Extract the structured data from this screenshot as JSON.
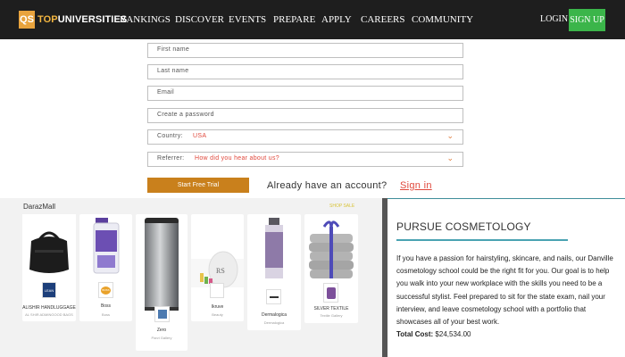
{
  "header": {
    "logo_mark": "QS",
    "logo_word_a": "TOP",
    "logo_word_b": "UNIVERSITIES",
    "nav": [
      "RANKINGS",
      "DISCOVER",
      "EVENTS",
      "PREPARE",
      "APPLY",
      "CAREERS",
      "COMMUNITY"
    ],
    "login": "LOGIN",
    "signup": "SIGN UP"
  },
  "form": {
    "first_name": "First name",
    "last_name": "Last name",
    "email": "Email",
    "password": "Create a password",
    "country_label": "Country:",
    "country_value": "USA",
    "referrer_label": "Referrer:",
    "referrer_value": "How did you hear about us?",
    "start_button": "Start Free Trial",
    "account_prompt": "Already have an account?",
    "sign_in": "Sign in"
  },
  "ad": {
    "brand": "DarazMall",
    "cta": "SHOP SALE",
    "products": [
      {
        "title": "ALISHIR HANDLUGGAGE",
        "subtitle": "AL SHIR ADMINGOOD BAGS",
        "logo": "LEAN"
      },
      {
        "title": "Boss",
        "subtitle": "Boss",
        "logo": "BOSS"
      },
      {
        "title": "Zero",
        "subtitle": "Parvi Gallery",
        "logo": ""
      },
      {
        "title": "Ikruve",
        "subtitle": "Beauty",
        "logo": ""
      },
      {
        "title": "Dermalogica",
        "subtitle": "Dermalogica",
        "logo": ""
      },
      {
        "title": "SILVER TEXTILE",
        "subtitle": "Textile Gallery",
        "logo": ""
      }
    ]
  },
  "course": {
    "title": "PURSUE COSMETOLOGY",
    "description": "If you have a passion for hairstyling, skincare, and nails, our Danville cosmetology school could be the right fit for you. Our goal is to help you walk into your new workplace with the skills you need to be a successful stylist. Feel prepared to sit for the state exam, nail your interview, and leave cosmetology school with a portfolio that showcases all of your best work.",
    "total_label": "Total Cost:",
    "total_value": "$24,534.00"
  },
  "colors": {
    "nav_bg": "#1e1e1e",
    "logo_accent": "#f2b540",
    "signup_green": "#3bb54a",
    "cta_orange": "#c9801c",
    "link_red": "#e0483c",
    "teal_rule": "#4aa3b2"
  }
}
